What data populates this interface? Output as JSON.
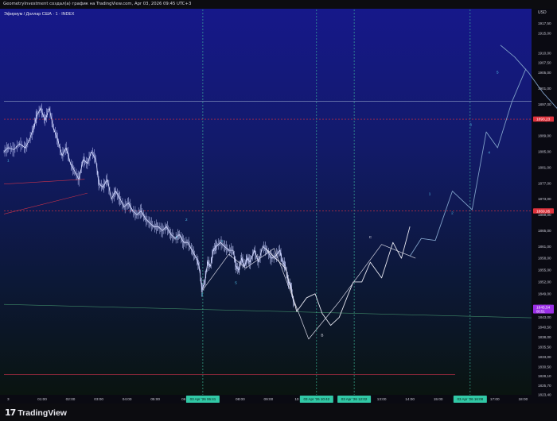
{
  "header": {
    "caption": "GeometryInvestment создал(а) график на TradingView.com, Apr 03, 2026 09:45 UTC+3"
  },
  "footer": {
    "brand": "TradingView",
    "logo_icon": "tradingview-logo-icon"
  },
  "chart_data": {
    "type": "line",
    "title": "Эфириум / Доллар США · 1 · INDEX",
    "currency": "USD",
    "y_axis": {
      "ylim": [
        1823.4,
        1919.0
      ],
      "ticks": [
        "1917,50",
        "1915,00",
        "1910,00",
        "1907,50",
        "1905,00",
        "1901,00",
        "1897,00",
        "1893,00",
        "1889,00",
        "1885,00",
        "1881,00",
        "1877,00",
        "1873,00",
        "1869,00",
        "1865,00",
        "1861,00",
        "1858,00",
        "1855,00",
        "1852,00",
        "1849,00",
        "1846,00",
        "1843,00",
        "1840,50",
        "1838,00",
        "1835,50",
        "1833,00",
        "1830,50",
        "1828,10",
        "1825,70",
        "1823,40"
      ],
      "tick_values": [
        1917.5,
        1915,
        1910,
        1907.5,
        1905,
        1901,
        1897,
        1893,
        1889,
        1885,
        1881,
        1877,
        1873,
        1869,
        1865,
        1861,
        1858,
        1855,
        1852,
        1849,
        1846,
        1843,
        1840.5,
        1838,
        1835.5,
        1833,
        1830.5,
        1828.1,
        1825.7,
        1823.4
      ]
    },
    "x_axis": {
      "ticks": [
        "3",
        "01:00",
        "02:00",
        "03:00",
        "04:00",
        "05:00",
        "06",
        "08:00",
        "09:00",
        "10",
        "13:00",
        "14:00",
        "15:00",
        "17:00",
        "18:00"
      ],
      "tick_values": [
        -0.2,
        1,
        2,
        3,
        4,
        5,
        6,
        8,
        9,
        10,
        13,
        14,
        15,
        17,
        18
      ],
      "highlighted": [
        {
          "label": "03 Apr '26   06:41",
          "t": 6.68
        },
        {
          "label": "03 Apr '26   10:42",
          "t": 10.7
        },
        {
          "label": "03 Apr '26   12:02",
          "t": 12.03
        },
        {
          "label": "03 Apr '26   16:08",
          "t": 16.13
        }
      ],
      "xlim": [
        -0.35,
        18.3
      ]
    },
    "price_labels": [
      {
        "text": "1893,23",
        "value": 1893.23,
        "color": "#e0323c"
      },
      {
        "text": "1869,95",
        "value": 1869.95,
        "color": "#e0323c"
      },
      {
        "text": "1845,54",
        "value": 1845.54,
        "sub": "00:51",
        "color": "#9a2ee6"
      }
    ],
    "horizontal_lines": [
      {
        "value": 1897.8,
        "t0": -0.35,
        "t1": 18.3,
        "color": "#8fa0c8",
        "dash": "none"
      },
      {
        "value": 1893.23,
        "t0": -0.35,
        "t1": 18.3,
        "color": "#e0323c",
        "dash": "2,2"
      },
      {
        "value": 1869.95,
        "t0": -0.35,
        "t1": 18.3,
        "color": "#e0323c",
        "dash": "2,2"
      },
      {
        "value": 1828.5,
        "t0": -0.35,
        "t1": 15.6,
        "color": "#c8324a",
        "dash": "none"
      }
    ],
    "vertical_lines_t": [
      6.68,
      10.7,
      12.03,
      16.13
    ],
    "trend_lines": [
      {
        "from": [
          -0.35,
          1876.8
        ],
        "to": [
          2.5,
          1878.0
        ],
        "color": "#c8324a"
      },
      {
        "from": [
          -0.35,
          1869.2
        ],
        "to": [
          2.6,
          1874.5
        ],
        "color": "#c8324a"
      },
      {
        "from": [
          -0.35,
          1846.3
        ],
        "to": [
          18.3,
          1842.9
        ],
        "color": "#3f8a68"
      }
    ],
    "price_series": {
      "name": "ETH/USD",
      "t": [
        -0.35,
        -0.2,
        0,
        0.2,
        0.4,
        0.55,
        0.7,
        0.8,
        0.95,
        1.1,
        1.25,
        1.4,
        1.55,
        1.7,
        1.85,
        2.0,
        2.15,
        2.3,
        2.45,
        2.6,
        2.75,
        2.9,
        3.0,
        3.15,
        3.3,
        3.45,
        3.6,
        3.75,
        3.9,
        4.05,
        4.2,
        4.35,
        4.5,
        4.65,
        4.8,
        4.95,
        5.1,
        5.25,
        5.4,
        5.55,
        5.7,
        5.85,
        6.0,
        6.15,
        6.3,
        6.45,
        6.55,
        6.65,
        6.75,
        6.85,
        6.95,
        7.05,
        7.15,
        7.3,
        7.45,
        7.6,
        7.75,
        7.85,
        7.95,
        8.05,
        8.15,
        8.25,
        8.35,
        8.5,
        8.65,
        8.8,
        8.95,
        9.1,
        9.25,
        9.4,
        9.5,
        9.6,
        9.7,
        9.8,
        9.9
      ],
      "values": [
        1885,
        1886,
        1885.5,
        1887,
        1886,
        1888,
        1891,
        1894,
        1896,
        1893,
        1896,
        1891,
        1888,
        1884,
        1886,
        1882,
        1880,
        1878,
        1883,
        1882,
        1885,
        1883,
        1877,
        1876,
        1878,
        1873,
        1875,
        1873,
        1871,
        1872,
        1870,
        1869,
        1870,
        1868,
        1867,
        1866,
        1866,
        1865,
        1866,
        1864,
        1863,
        1864,
        1862,
        1862,
        1860,
        1858,
        1856,
        1850,
        1852,
        1857,
        1856,
        1860,
        1861,
        1862,
        1861,
        1860,
        1860,
        1856,
        1855,
        1858,
        1856,
        1858,
        1857,
        1860,
        1857,
        1861,
        1860,
        1858,
        1858.5,
        1860,
        1857,
        1856,
        1852,
        1851,
        1846
      ]
    },
    "forecast_paths": [
      {
        "name": "primary",
        "color": "#e6e6f0",
        "width": 0.9,
        "t": [
          8.9,
          9.6,
          10.0,
          10.35,
          10.65,
          10.9,
          11.2,
          11.5,
          11.8,
          12.0,
          12.3,
          12.6,
          13.0,
          13.4,
          13.7,
          14.0
        ],
        "v": [
          1860.5,
          1855.5,
          1844.5,
          1848,
          1849,
          1844,
          1841,
          1843,
          1848.5,
          1852,
          1852,
          1857,
          1853,
          1862,
          1858,
          1866
        ]
      },
      {
        "name": "zigzag",
        "color": "#d8d8e6",
        "width": 0.7,
        "t": [
          6.68,
          7.6,
          8.2,
          9.2,
          10.42,
          11.5,
          13.0,
          14.2
        ],
        "v": [
          1850,
          1859,
          1855.5,
          1860.5,
          1837.5,
          1847,
          1861.5,
          1858
        ]
      },
      {
        "name": "wave",
        "color": "#7fa0c8",
        "width": 0.9,
        "t": [
          14.0,
          14.4,
          14.9,
          15.5,
          16.2,
          16.7,
          17.1,
          17.6,
          18.1
        ],
        "v": [
          1858.5,
          1863,
          1862.5,
          1875,
          1870.3,
          1890,
          1886,
          1897.5,
          1906
        ]
      },
      {
        "name": "arc",
        "color": "#7fa0c8",
        "width": 0.9,
        "t": [
          17.2,
          17.7,
          18.2,
          18.7,
          19.2,
          19.35
        ],
        "v": [
          1912,
          1909,
          1905,
          1900,
          1896,
          1899
        ]
      }
    ],
    "wave_labels": [
      {
        "text": "1",
        "t": -0.2,
        "v": 1882.5,
        "color": "#52c0e8"
      },
      {
        "text": "2",
        "t": 6.1,
        "v": 1867.5,
        "color": "#52c0e8"
      },
      {
        "text": "1",
        "t": 5.75,
        "v": 1863,
        "color": "#52c0e8"
      },
      {
        "text": "3",
        "t": 6.65,
        "v": 1848.5,
        "color": "#52c0e8"
      },
      {
        "text": "4",
        "t": 7.35,
        "v": 1862,
        "color": "#52c0e8"
      },
      {
        "text": "5",
        "t": 7.85,
        "v": 1851.5,
        "color": "#52c0e8"
      },
      {
        "text": "A",
        "t": 8.6,
        "v": 1858.3,
        "color": "#e6e6f0"
      },
      {
        "text": "B",
        "t": 10.9,
        "v": 1838.2,
        "color": "#e6e6f0"
      },
      {
        "text": "C",
        "t": 12.6,
        "v": 1863,
        "color": "#e6e6f0"
      },
      {
        "text": "1",
        "t": 14.7,
        "v": 1874,
        "color": "#52c0e8"
      },
      {
        "text": "2",
        "t": 15.5,
        "v": 1869.2,
        "color": "#52c0e8"
      },
      {
        "text": "3",
        "t": 16.15,
        "v": 1891.5,
        "color": "#52c0e8"
      },
      {
        "text": "4",
        "t": 16.8,
        "v": 1884.5,
        "color": "#52c0e8"
      },
      {
        "text": "5",
        "t": 17.1,
        "v": 1904.8,
        "color": "#52c0e8"
      }
    ]
  }
}
